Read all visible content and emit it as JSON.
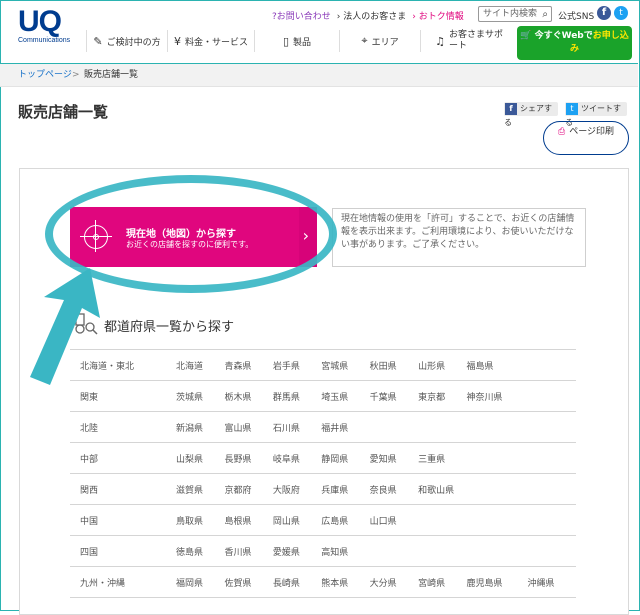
{
  "logo": {
    "brand": "UQ",
    "sub": "Communications"
  },
  "toplinks": {
    "contact": "?お問い合わせ",
    "business": "› 法人のお客さま",
    "deals": "› おトク情報"
  },
  "search": {
    "placeholder": "サイト内検索"
  },
  "sns": {
    "label": "公式SNS"
  },
  "nav": [
    {
      "icon": "✎",
      "label": "ご検討中の方"
    },
    {
      "icon": "¥",
      "label": "料金・サービス"
    },
    {
      "icon": "▯",
      "label": "製品"
    },
    {
      "icon": "⌖",
      "label": "エリア"
    },
    {
      "icon": "♫",
      "label": "お客さまサポート"
    }
  ],
  "cta": {
    "prefix": "今すぐWebで",
    "highlight": "お申し込み"
  },
  "breadcrumb": {
    "home": "トップページ",
    "sep": ">",
    "current": "販売店舗一覧"
  },
  "page": {
    "title": "販売店舗一覧"
  },
  "share": {
    "facebook": "シェアする",
    "twitter": "ツイートする"
  },
  "print": {
    "label": "ページ印刷"
  },
  "location": {
    "title": "現在地（地図）から探す",
    "subtitle": "お近くの店舗を探すのに便利です。"
  },
  "note": {
    "text": "現在地情報の使用を「許可」することで、お近くの店舗情報を表示出来ます。ご利用環境により、お使いいただけない事があります。ご了承ください。"
  },
  "prefectures": {
    "heading": "都道府県一覧から探す",
    "rows": [
      {
        "region": "北海道・東北",
        "items": [
          "北海道",
          "青森県",
          "岩手県",
          "宮城県",
          "秋田県",
          "山形県",
          "福島県"
        ]
      },
      {
        "region": "関東",
        "items": [
          "茨城県",
          "栃木県",
          "群馬県",
          "埼玉県",
          "千葉県",
          "東京都",
          "神奈川県"
        ]
      },
      {
        "region": "北陸",
        "items": [
          "新潟県",
          "富山県",
          "石川県",
          "福井県"
        ]
      },
      {
        "region": "中部",
        "items": [
          "山梨県",
          "長野県",
          "岐阜県",
          "静岡県",
          "愛知県",
          "三重県"
        ]
      },
      {
        "region": "関西",
        "items": [
          "滋賀県",
          "京都府",
          "大阪府",
          "兵庫県",
          "奈良県",
          "和歌山県"
        ]
      },
      {
        "region": "中国",
        "items": [
          "鳥取県",
          "島根県",
          "岡山県",
          "広島県",
          "山口県"
        ]
      },
      {
        "region": "四国",
        "items": [
          "徳島県",
          "香川県",
          "愛媛県",
          "高知県"
        ]
      },
      {
        "region": "九州・沖縄",
        "items": [
          "福岡県",
          "佐賀県",
          "長崎県",
          "熊本県",
          "大分県",
          "宮崎県",
          "鹿児島県",
          "沖縄県"
        ]
      }
    ]
  },
  "colors": {
    "accent": "#e0067e",
    "brand": "#003c8f",
    "cta": "#1aa32a",
    "annotation": "#3ab6c4"
  }
}
